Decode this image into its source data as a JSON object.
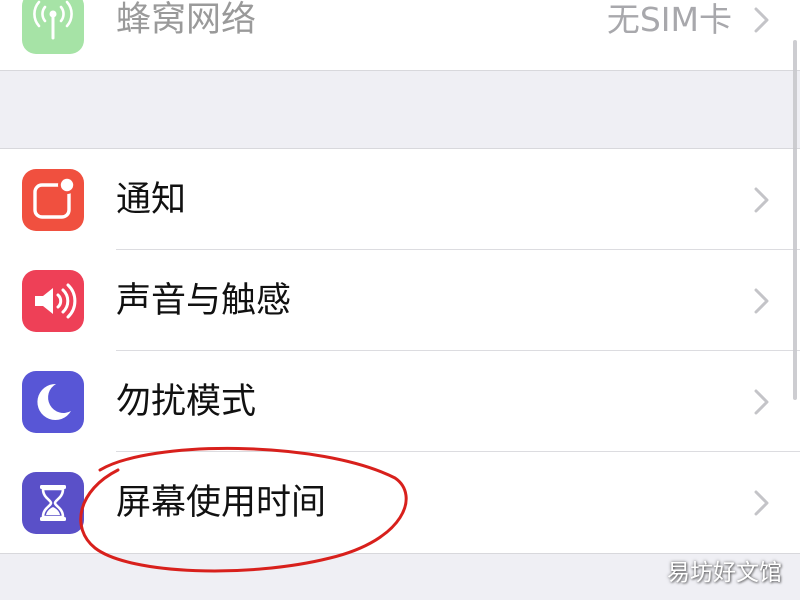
{
  "colors": {
    "cellular_icon_bg": "#a6e3a6",
    "notifications_icon_bg": "#f0503f",
    "sounds_icon_bg": "#ee4057",
    "dnd_icon_bg": "#5856d6",
    "screen_time_icon_bg": "#5a50c8",
    "annotation_circle": "#d8201c"
  },
  "top_group": {
    "rows": [
      {
        "label": "蜂窝网络",
        "value": "无SIM卡",
        "icon": "antenna-icon"
      }
    ]
  },
  "main_group": {
    "rows": [
      {
        "label": "通知",
        "icon": "notifications-icon"
      },
      {
        "label": "声音与触感",
        "icon": "speaker-icon"
      },
      {
        "label": "勿扰模式",
        "icon": "moon-icon"
      },
      {
        "label": "屏幕使用时间",
        "icon": "hourglass-icon",
        "highlighted": true
      }
    ]
  },
  "watermark": "易坊好文馆"
}
